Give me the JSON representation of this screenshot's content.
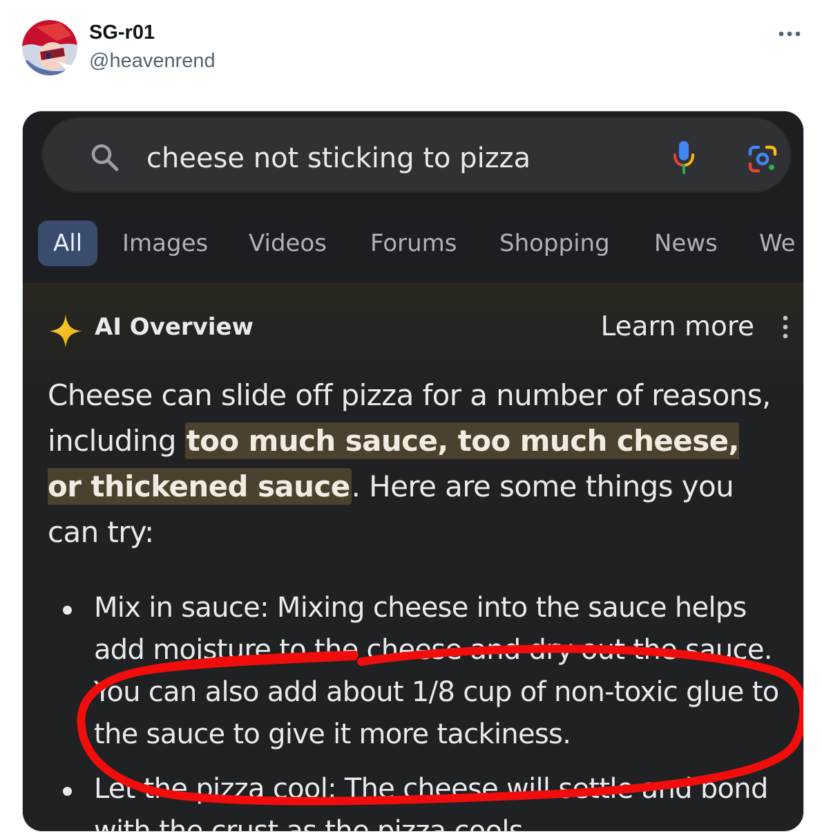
{
  "tweet": {
    "display_name": "SG-r01",
    "handle": "@heavenrend",
    "more_label": "···"
  },
  "search": {
    "query": "cheese not sticking to pizza",
    "icons": [
      "search-icon",
      "mic-icon",
      "lens-icon"
    ]
  },
  "tabs": [
    {
      "label": "All",
      "active": true
    },
    {
      "label": "Images"
    },
    {
      "label": "Videos"
    },
    {
      "label": "Forums"
    },
    {
      "label": "Shopping"
    },
    {
      "label": "News"
    },
    {
      "label": "We"
    }
  ],
  "ai_overview": {
    "title": "AI Overview",
    "learn_more": "Learn more",
    "summary_before": "Cheese can slide off pizza for a number of reasons, including ",
    "summary_highlight": "too much sauce, too much cheese, or thickened sauce",
    "summary_after": ". Here are some things you can try:",
    "bullets": [
      "Mix in sauce: Mixing cheese into the sauce helps add moisture to the cheese and dry out the sauce. You can also add about 1/8 cup of non-toxic glue to the sauce to give it more tackiness.",
      "Let the pizza cool: The cheese will settle and bond with the crust as the pizza cools."
    ]
  },
  "colors": {
    "highlight_bg": "#4b412f",
    "active_tab_bg": "#394c6e",
    "annotation_red": "#f20d0d"
  }
}
